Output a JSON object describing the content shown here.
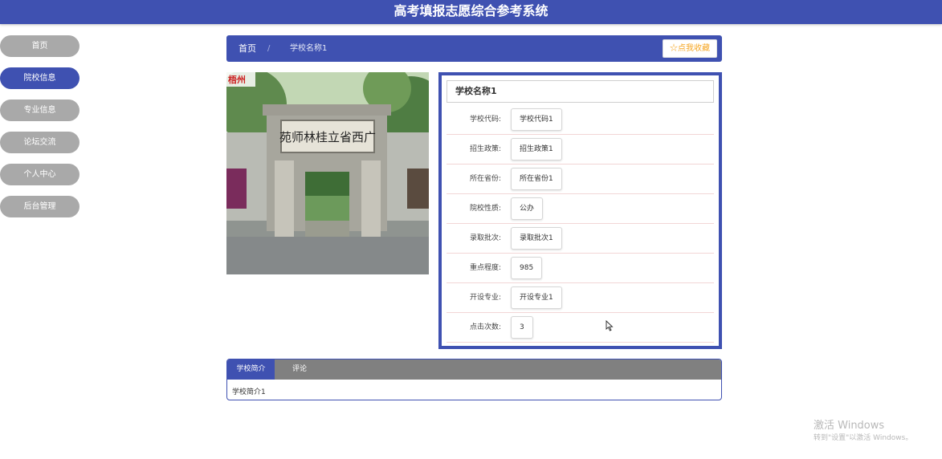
{
  "header": {
    "title": "高考填报志愿综合参考系统"
  },
  "sidebar": {
    "items": [
      {
        "label": "首页",
        "active": false
      },
      {
        "label": "院校信息",
        "active": true
      },
      {
        "label": "专业信息",
        "active": false
      },
      {
        "label": "论坛交流",
        "active": false
      },
      {
        "label": "个人中心",
        "active": false
      },
      {
        "label": "后台管理",
        "active": false
      }
    ]
  },
  "breadcrumb": {
    "home": "首页",
    "separator": "/",
    "current": "学校名称1"
  },
  "favorite_button": {
    "label": "☆点我收藏"
  },
  "photo": {
    "sign_text": "苑师林桂立省西广",
    "logo_text": "梧州"
  },
  "detail": {
    "title": "学校名称1",
    "rows": [
      {
        "label": "学校代码:",
        "value": "学校代码1"
      },
      {
        "label": "招生政策:",
        "value": "招生政策1"
      },
      {
        "label": "所在省份:",
        "value": "所在省份1"
      },
      {
        "label": "院校性质:",
        "value": "公办"
      },
      {
        "label": "录取批次:",
        "value": "录取批次1"
      },
      {
        "label": "重点程度:",
        "value": "985"
      },
      {
        "label": "开设专业:",
        "value": "开设专业1"
      },
      {
        "label": "点击次数:",
        "value": "3"
      }
    ]
  },
  "tabs": {
    "items": [
      {
        "label": "学校简介",
        "active": true
      },
      {
        "label": "评论",
        "active": false
      }
    ],
    "content": "学校简介1"
  },
  "watermark": {
    "line1": "激活 Windows",
    "line2": "转到\"设置\"以激活 Windows。"
  },
  "colors": {
    "primary": "#3f51b1",
    "sidebar_inactive": "#a9a9a9",
    "tab_bar": "#808080",
    "favorite_text": "#f5a623"
  }
}
